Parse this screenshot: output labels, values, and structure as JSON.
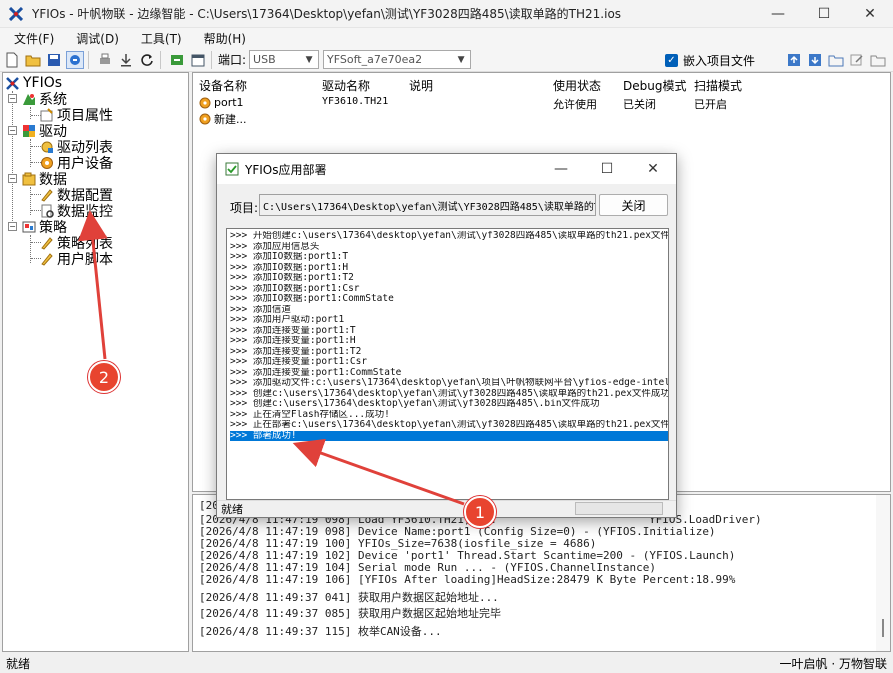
{
  "window": {
    "title": "YFIOs - 叶帆物联 - 边缘智能 - C:\\Users\\17364\\Desktop\\yefan\\测试\\YF3028四路485\\读取单路的TH21.ios",
    "minimize": "—",
    "maximize": "☐",
    "close": "✕"
  },
  "menu": [
    "文件(F)",
    "调试(D)",
    "工具(T)",
    "帮助(H)"
  ],
  "toolbar": {
    "port_label": "端口:",
    "port_value": "USB",
    "device_value": "YFSoft_a7e70ea2",
    "embed_label": "嵌入项目文件",
    "embed_checked": "✓"
  },
  "tree": {
    "root": "YFIOs",
    "system": "系统",
    "project_props": "项目属性",
    "driver": "驱动",
    "driver_list": "驱动列表",
    "user_devices": "用户设备",
    "data": "数据",
    "data_config": "数据配置",
    "data_monitor": "数据监控",
    "strategy": "策略",
    "strategy_list": "策略列表",
    "user_scripts": "用户脚本"
  },
  "device_table": {
    "headers": [
      "设备名称",
      "驱动名称",
      "说明",
      "使用状态",
      "Debug模式",
      "扫描模式"
    ],
    "rows": [
      [
        "port1",
        "YF3610.TH21",
        "",
        "允许使用",
        "已关闭",
        "已开启"
      ],
      [
        "新建...",
        "",
        "",
        "",
        "",
        ""
      ]
    ]
  },
  "log": {
    "lines": [
      "[202",
      "[2026/4/8 11:47:19 098] Load YF3610.TH21, ...",
      "[2026/4/8 11:47:19 098] Device Name:port1 (Config Size=0) - (YFIOS.Initialize)",
      "[2026/4/8 11:47:19 100] YFIOs_Size=7638(iosfile_size = 4686)",
      "[2026/4/8 11:47:19 102] Device 'port1' Thread.Start Scantime=200 - (YFIOS.Launch)",
      "[2026/4/8 11:47:19 104] Serial mode Run ... - (YFIOS.ChannelInstance)",
      "[2026/4/8 11:47:19 106] [YFIOs After loading]HeadSize:28479 K Byte Percent:18.99%",
      "[2026/4/8 11:49:37 041] 获取用户数据区起始地址...",
      "[2026/4/8 11:49:37 085] 获取用户数据区起始地址完毕",
      "[2026/4/8 11:49:37 115] 枚举CAN设备..."
    ],
    "log_driver_fragment": "YFIOS.LoadDriver)"
  },
  "status": {
    "left": "就绪",
    "right": "一叶启帆 · 万物智联"
  },
  "dialog": {
    "title": "YFIOs应用部署",
    "project_label": "项目:",
    "project_path": "C:\\Users\\17364\\Desktop\\yefan\\测试\\YF3028四路485\\读取单路的TH21",
    "close_button": "关闭",
    "output": [
      ">>> 开始创建c:\\users\\17364\\desktop\\yefan\\测试\\yf3028四路485\\读取单路的th21.pex文件",
      ">>> 添加应用信息头",
      ">>> 添加IO数据:port1:T",
      ">>> 添加IO数据:port1:H",
      ">>> 添加IO数据:port1:T2",
      ">>> 添加IO数据:port1:Csr",
      ">>> 添加IO数据:port1:CommState",
      ">>> 添加信道",
      ">>> 添加用户驱动:port1",
      ">>> 添加连接变量:port1:T",
      ">>> 添加连接变量:port1:H",
      ">>> 添加连接变量:port1:T2",
      ">>> 添加连接变量:port1:Csr",
      ">>> 添加连接变量:port1:CommState",
      ">>> 添加驱动文件:c:\\users\\17364\\desktop\\yefan\\项目\\叶帆物联网平台\\yfios-edge-intel",
      ">>> 创建c:\\users\\17364\\desktop\\yefan\\测试\\yf3028四路485\\读取单路的th21.pex文件成功",
      ">>> 创建c:\\users\\17364\\desktop\\yefan\\测试\\yf3028四路485\\.bin文件成功",
      ">>> 正在清空Flash存储区...成功!",
      ">>> 正在部署c:\\users\\17364\\desktop\\yefan\\测试\\yf3028四路485\\读取单路的th21.pex文件",
      ">>> 部署成功!"
    ],
    "status": "就绪"
  },
  "annotations": [
    "1",
    "2"
  ],
  "colors": {
    "selection": "#0078d7",
    "badge": "#e8442f",
    "arrow": "#e0413a"
  }
}
